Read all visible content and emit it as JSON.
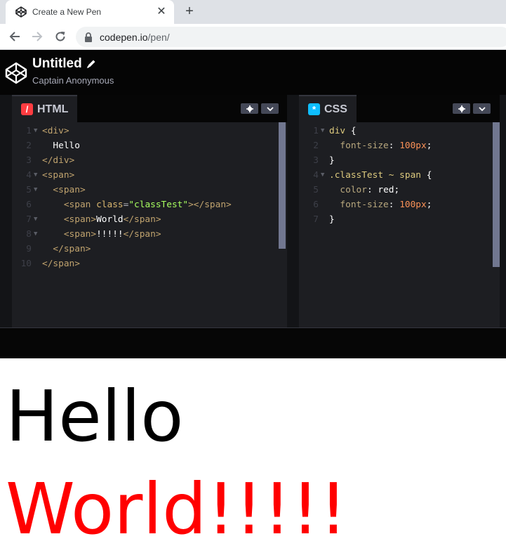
{
  "browser": {
    "tab_title": "Create a New Pen",
    "url_host": "codepen.io",
    "url_path": "/pen/"
  },
  "pen": {
    "title": "Untitled",
    "author": "Captain Anonymous"
  },
  "editors": {
    "html": {
      "label": "HTML",
      "icon_glyph": "/",
      "icon_color": "#ff3c41",
      "lines": [
        {
          "n": "1",
          "fold": true,
          "code": "<div>"
        },
        {
          "n": "2",
          "fold": false,
          "code": "  Hello"
        },
        {
          "n": "3",
          "fold": false,
          "code": "</div>"
        },
        {
          "n": "4",
          "fold": true,
          "code": "<span>"
        },
        {
          "n": "5",
          "fold": true,
          "code": "  <span>"
        },
        {
          "n": "6",
          "fold": false,
          "code": "    <span class=\"classTest\"></span>"
        },
        {
          "n": "7",
          "fold": true,
          "code": "    <span>World</span>"
        },
        {
          "n": "8",
          "fold": true,
          "code": "    <span>!!!!!</span>"
        },
        {
          "n": "9",
          "fold": false,
          "code": "  </span>"
        },
        {
          "n": "10",
          "fold": false,
          "code": "</span>"
        }
      ]
    },
    "css": {
      "label": "CSS",
      "icon_glyph": "*",
      "icon_color": "#0ebeff",
      "lines": [
        {
          "n": "1",
          "fold": true,
          "code": "div {"
        },
        {
          "n": "2",
          "fold": false,
          "code": "  font-size: 100px;"
        },
        {
          "n": "3",
          "fold": false,
          "code": "}"
        },
        {
          "n": "4",
          "fold": true,
          "code": ".classTest ~ span {"
        },
        {
          "n": "5",
          "fold": false,
          "code": "  color: red;"
        },
        {
          "n": "6",
          "fold": false,
          "code": "  font-size: 100px;"
        },
        {
          "n": "7",
          "fold": false,
          "code": "}"
        }
      ]
    }
  },
  "result": {
    "line1": "Hello",
    "line2": "World!!!!!",
    "line2_color": "#ff0000"
  },
  "icons": {
    "back": "arrow-left-icon",
    "forward": "arrow-right-icon",
    "reload": "reload-icon",
    "lock": "lock-icon",
    "settings": "gear-icon",
    "collapse": "chevron-down-icon",
    "logo": "codepen-logo-icon",
    "edit": "pencil-icon"
  }
}
